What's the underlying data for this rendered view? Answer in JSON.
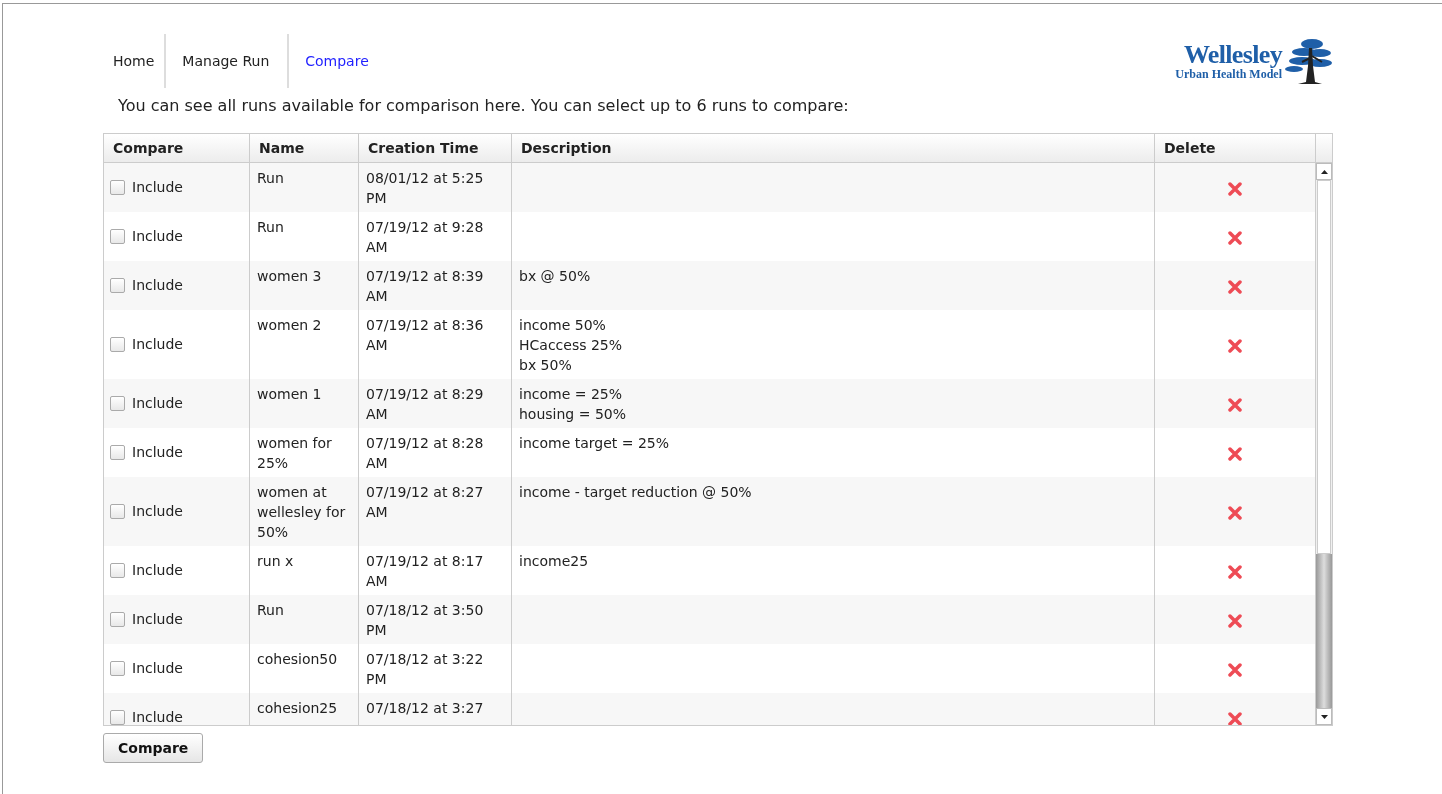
{
  "nav": [
    {
      "label": "Home",
      "selected": false
    },
    {
      "label": "Manage Run",
      "selected": false
    },
    {
      "label": "Compare",
      "selected": true
    }
  ],
  "logo": {
    "name": "Wellesley",
    "subtitle": "Urban Health Model"
  },
  "intro": "You can see all runs available for comparison here. You can select up to 6 runs to compare:",
  "table": {
    "columns": [
      "Compare",
      "Name",
      "Creation Time",
      "Description",
      "Delete"
    ],
    "rows": [
      {
        "include": "Include",
        "checked": false,
        "name": "Run",
        "time": "08/01/12 at 5:25 PM",
        "description": []
      },
      {
        "include": "Include",
        "checked": false,
        "name": "Run",
        "time": "07/19/12 at 9:28 AM",
        "description": []
      },
      {
        "include": "Include",
        "checked": false,
        "name": "women 3",
        "time": "07/19/12 at 8:39 AM",
        "description": [
          "bx @ 50%"
        ]
      },
      {
        "include": "Include",
        "checked": false,
        "name": "women 2",
        "time": "07/19/12 at 8:36 AM",
        "description": [
          "income 50%",
          "HCaccess 25%",
          "bx 50%"
        ]
      },
      {
        "include": "Include",
        "checked": false,
        "name": "women 1",
        "time": "07/19/12 at 8:29 AM",
        "description": [
          "income = 25%",
          "housing = 50%"
        ]
      },
      {
        "include": "Include",
        "checked": false,
        "name": "women for 25%",
        "time": "07/19/12 at 8:28 AM",
        "description": [
          "income target = 25%"
        ]
      },
      {
        "include": "Include",
        "checked": false,
        "name": "women at wellesley for 50%",
        "time": "07/19/12 at 8:27 AM",
        "description": [
          "income - target reduction @ 50%"
        ]
      },
      {
        "include": "Include",
        "checked": false,
        "name": "run x",
        "time": "07/19/12 at 8:17 AM",
        "description": [
          "income25"
        ]
      },
      {
        "include": "Include",
        "checked": false,
        "name": "Run",
        "time": "07/18/12 at 3:50 PM",
        "description": []
      },
      {
        "include": "Include",
        "checked": false,
        "name": "cohesion50",
        "time": "07/18/12 at 3:22 PM",
        "description": []
      },
      {
        "include": "Include",
        "checked": false,
        "name": "cohesion25",
        "time": "07/18/12 at 3:27",
        "description": []
      }
    ]
  },
  "button": "Compare"
}
